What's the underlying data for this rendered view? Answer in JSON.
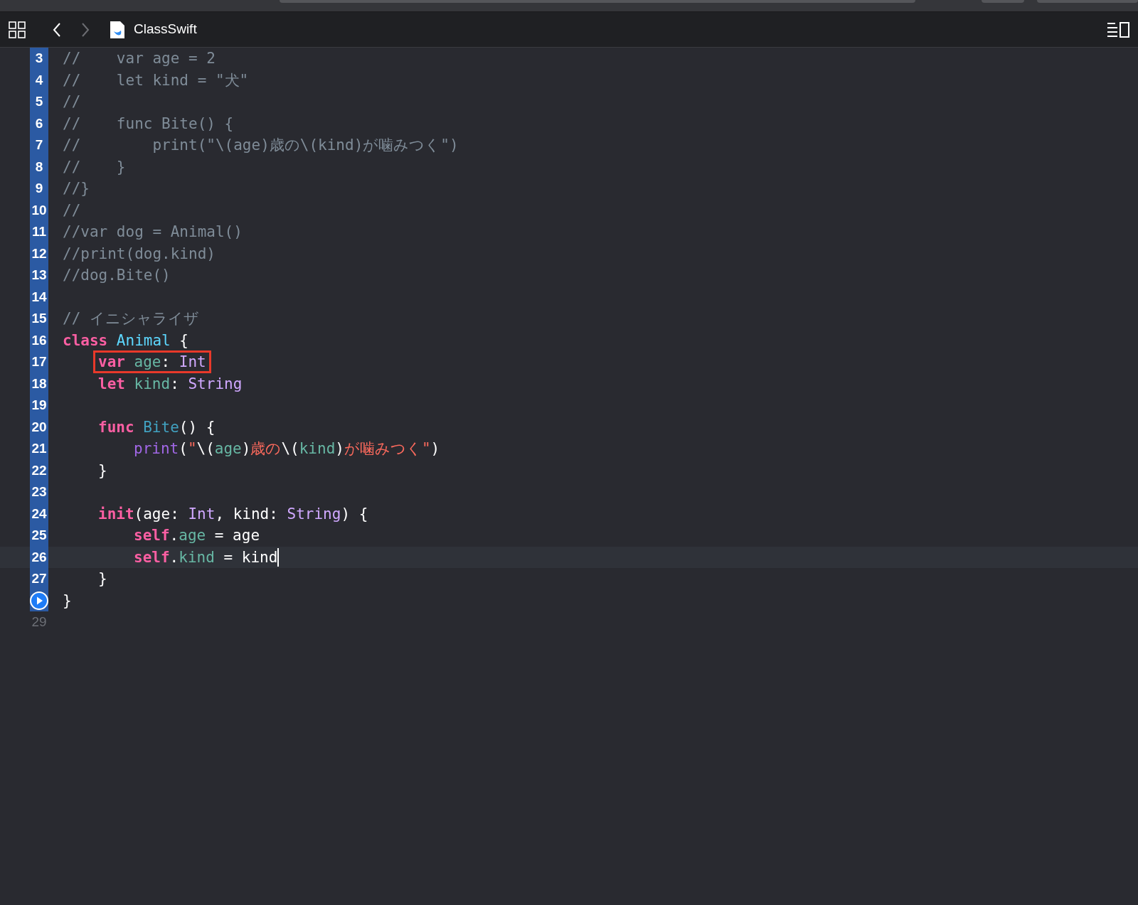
{
  "toolbar": {
    "file_name": "ClassSwift"
  },
  "lines": [
    {
      "number": "3",
      "in_range": true,
      "tokens": [
        {
          "kind": "comment",
          "t": "//    var age = 2"
        }
      ]
    },
    {
      "number": "4",
      "in_range": true,
      "tokens": [
        {
          "kind": "comment",
          "t": "//    let kind = \"犬\""
        }
      ]
    },
    {
      "number": "5",
      "in_range": true,
      "tokens": [
        {
          "kind": "comment",
          "t": "//"
        }
      ]
    },
    {
      "number": "6",
      "in_range": true,
      "tokens": [
        {
          "kind": "comment",
          "t": "//    func Bite() {"
        }
      ]
    },
    {
      "number": "7",
      "in_range": true,
      "tokens": [
        {
          "kind": "comment",
          "t": "//        print(\"\\(age)歳の\\(kind)が噛みつく\")"
        }
      ]
    },
    {
      "number": "8",
      "in_range": true,
      "tokens": [
        {
          "kind": "comment",
          "t": "//    }"
        }
      ]
    },
    {
      "number": "9",
      "in_range": true,
      "tokens": [
        {
          "kind": "comment",
          "t": "//}"
        }
      ]
    },
    {
      "number": "10",
      "in_range": true,
      "tokens": [
        {
          "kind": "comment",
          "t": "//"
        }
      ]
    },
    {
      "number": "11",
      "in_range": true,
      "tokens": [
        {
          "kind": "comment",
          "t": "//var dog = Animal()"
        }
      ]
    },
    {
      "number": "12",
      "in_range": true,
      "tokens": [
        {
          "kind": "comment",
          "t": "//print(dog.kind)"
        }
      ]
    },
    {
      "number": "13",
      "in_range": true,
      "tokens": [
        {
          "kind": "comment",
          "t": "//dog.Bite()"
        }
      ]
    },
    {
      "number": "14",
      "in_range": true
    },
    {
      "number": "15",
      "in_range": true,
      "tokens": [
        {
          "kind": "comment",
          "t": "// イニシャライザ"
        }
      ]
    },
    {
      "number": "16",
      "in_range": true,
      "tokens": [
        {
          "kind": "keyword",
          "t": "class "
        },
        {
          "kind": "decl",
          "t": "Animal"
        },
        {
          "kind": "plain",
          "t": " {"
        }
      ],
      "children": [
        {
          "number": "17",
          "in_range": true,
          "boxed": true,
          "tokens": [
            {
              "kind": "keyword",
              "t": "var "
            },
            {
              "kind": "prop",
              "t": "age"
            },
            {
              "kind": "plain",
              "t": ": "
            },
            {
              "kind": "type",
              "t": "Int"
            }
          ]
        },
        {
          "number": "18",
          "in_range": true,
          "tokens": [
            {
              "kind": "keyword",
              "t": "let "
            },
            {
              "kind": "prop",
              "t": "kind"
            },
            {
              "kind": "plain",
              "t": ": "
            },
            {
              "kind": "type",
              "t": "String"
            }
          ]
        },
        {
          "number": "19",
          "in_range": true
        },
        {
          "number": "20",
          "in_range": true,
          "tokens": [
            {
              "kind": "keyword",
              "t": "func "
            },
            {
              "kind": "fname",
              "t": "Bite"
            },
            {
              "kind": "plain",
              "t": "() {"
            }
          ],
          "children": [
            {
              "number": "21",
              "in_range": true,
              "tokens": [
                {
                  "kind": "call",
                  "t": "print"
                },
                {
                  "kind": "plain",
                  "t": "("
                },
                {
                  "kind": "string",
                  "t": "\""
                },
                {
                  "kind": "plain",
                  "t": "\\("
                },
                {
                  "kind": "prop",
                  "t": "age"
                },
                {
                  "kind": "plain",
                  "t": ")"
                },
                {
                  "kind": "string",
                  "t": "歳の"
                },
                {
                  "kind": "plain",
                  "t": "\\("
                },
                {
                  "kind": "prop",
                  "t": "kind"
                },
                {
                  "kind": "plain",
                  "t": ")"
                },
                {
                  "kind": "string",
                  "t": "が噛みつく\""
                },
                {
                  "kind": "plain",
                  "t": ")"
                }
              ]
            }
          ]
        },
        {
          "number": "22",
          "in_range": true,
          "tokens": [
            {
              "kind": "plain",
              "t": "}"
            }
          ]
        },
        {
          "number": "23",
          "in_range": true
        },
        {
          "number": "24",
          "in_range": true,
          "tokens": [
            {
              "kind": "keyword",
              "t": "init"
            },
            {
              "kind": "plain",
              "t": "(age: "
            },
            {
              "kind": "type",
              "t": "Int"
            },
            {
              "kind": "plain",
              "t": ", kind: "
            },
            {
              "kind": "type",
              "t": "String"
            },
            {
              "kind": "plain",
              "t": ") {"
            }
          ],
          "children": [
            {
              "number": "25",
              "in_range": true,
              "tokens": [
                {
                  "kind": "keyword",
                  "t": "self"
                },
                {
                  "kind": "plain",
                  "t": "."
                },
                {
                  "kind": "prop",
                  "t": "age"
                },
                {
                  "kind": "plain",
                  "t": " = age"
                }
              ]
            },
            {
              "number": "26",
              "in_range": true,
              "current": true,
              "tokens": [
                {
                  "kind": "keyword",
                  "t": "self"
                },
                {
                  "kind": "plain",
                  "t": "."
                },
                {
                  "kind": "prop",
                  "t": "kind"
                },
                {
                  "kind": "plain",
                  "t": " = kind"
                }
              ]
            }
          ]
        },
        {
          "number": "27",
          "in_range": true,
          "tokens": [
            {
              "kind": "plain",
              "t": "}"
            }
          ]
        }
      ]
    },
    {
      "run_marker": true,
      "in_range": true,
      "tokens": [
        {
          "kind": "plain",
          "t": "}"
        }
      ]
    },
    {
      "number": "29",
      "in_range": false
    }
  ]
}
